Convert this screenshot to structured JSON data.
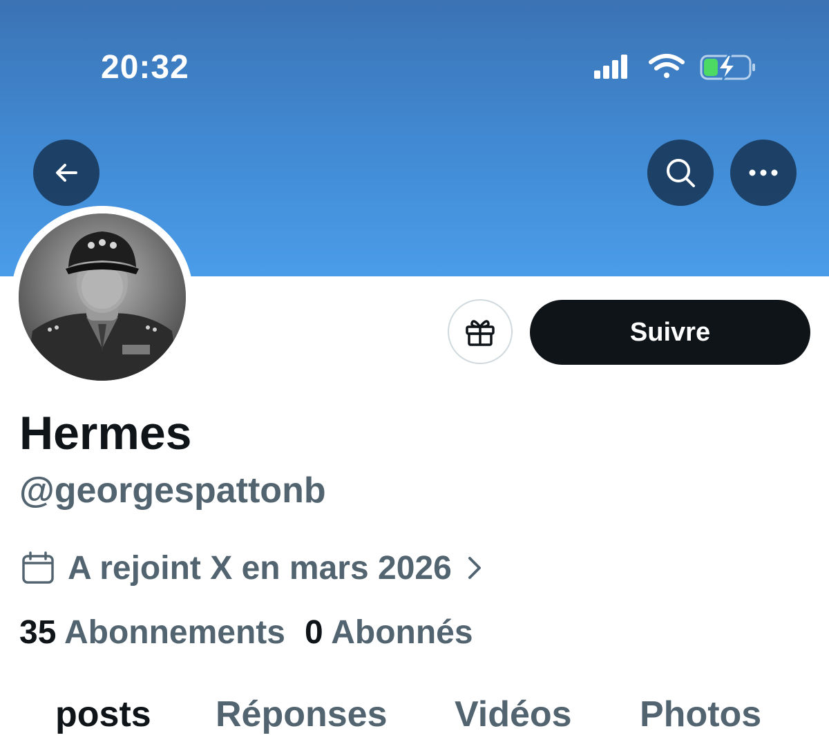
{
  "status_bar": {
    "time": "20:32",
    "icons": [
      "cellular-signal-icon",
      "wifi-icon",
      "battery-charging-icon"
    ]
  },
  "nav": {
    "back_icon": "arrow-left-icon",
    "search_icon": "search-icon",
    "more_icon": "more-horizontal-icon"
  },
  "profile": {
    "display_name": "Hermes",
    "handle": "@georgespattonb",
    "joined": "A rejoint X en mars 2026",
    "following_count": "35",
    "following_label": "Abonnements",
    "followers_count": "0",
    "followers_label": "Abonnés"
  },
  "actions": {
    "gift_icon": "gift-icon",
    "follow_label": "Suivre"
  },
  "tabs": [
    {
      "label": "posts",
      "active": true
    },
    {
      "label": "Réponses",
      "active": false
    },
    {
      "label": "Vidéos",
      "active": false
    },
    {
      "label": "Photos",
      "active": false
    }
  ],
  "colors": {
    "header_top": "#3b73b4",
    "header_bottom": "#4a9ce9",
    "primary_text": "#0f1419",
    "secondary_text": "#536471",
    "follow_button_bg": "#0f1419",
    "battery_fill": "#4cd964"
  }
}
